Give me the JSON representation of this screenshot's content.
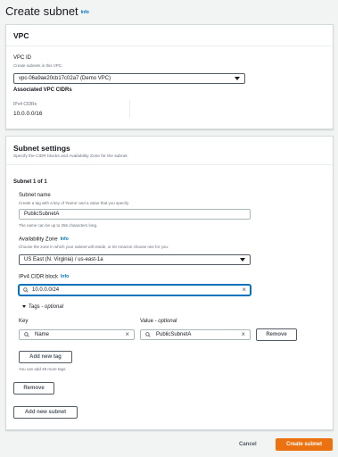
{
  "page": {
    "title": "Create subnet",
    "info": "Info"
  },
  "vpc": {
    "title": "VPC",
    "vpc_id_label": "VPC ID",
    "vpc_id_desc": "Create subnets in this VPC.",
    "vpc_id_value": "vpc-06a9ae20cb17c02a7 (Demo VPC)",
    "cidrs_heading": "Associated VPC CIDRs",
    "ipv4_label": "IPv4 CIDRs",
    "ipv4_value": "10.0.0.0/16"
  },
  "subnet_settings": {
    "title": "Subnet settings",
    "desc": "Specify the CIDR blocks and Availability Zone for the subnet.",
    "subnet_heading": "Subnet 1 of 1",
    "name_label": "Subnet name",
    "name_desc": "Create a tag with a key of 'Name' and a value that you specify.",
    "name_value": "PublicSubnetA",
    "name_hint": "The name can be up to 256 characters long.",
    "az_label": "Availability Zone",
    "az_info": "Info",
    "az_desc": "Choose the zone in which your subnet will reside, or let Amazon choose one for you.",
    "az_value": "US East (N. Virginia) / us-east-1a",
    "cidr_label": "IPv4 CIDR block",
    "cidr_info": "Info",
    "cidr_value": "10.0.0.0/24",
    "tags_label": "Tags",
    "tags_optional": " - optional",
    "key_label": "Key",
    "value_label": "Value",
    "value_optional": " - optional",
    "tag_key": "Name",
    "tag_value": "PublicSubnetA",
    "remove_tag": "Remove",
    "add_tag": "Add new tag",
    "tags_hint": "You can add 49 more tags.",
    "remove_subnet": "Remove",
    "add_subnet": "Add new subnet"
  },
  "footer": {
    "cancel": "Cancel",
    "create": "Create subnet"
  }
}
